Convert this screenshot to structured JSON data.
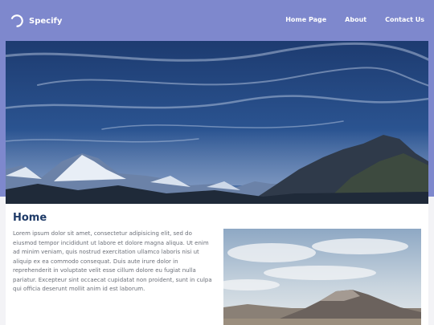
{
  "brand": {
    "name": "Specify"
  },
  "nav": {
    "items": [
      {
        "label": "Home Page"
      },
      {
        "label": "About"
      },
      {
        "label": "Contact Us"
      }
    ]
  },
  "main": {
    "heading": "Home",
    "body": "Lorem ipsum dolor sit amet, consectetur adipisicing elit, sed do eiusmod tempor incididunt ut labore et dolore magna aliqua. Ut enim ad minim veniam, quis nostrud exercitation ullamco laboris nisi ut aliquip ex ea commodo consequat. Duis aute irure dolor in reprehenderit in voluptate velit esse cillum dolore eu fugiat nulla pariatur. Excepteur sint occaecat cupidatat non proident, sunt in culpa qui officia deserunt mollit anim id est laborum."
  },
  "colors": {
    "header_bg": "#7e88cd",
    "heading": "#1f3b68",
    "body_text": "#6b6f78"
  }
}
